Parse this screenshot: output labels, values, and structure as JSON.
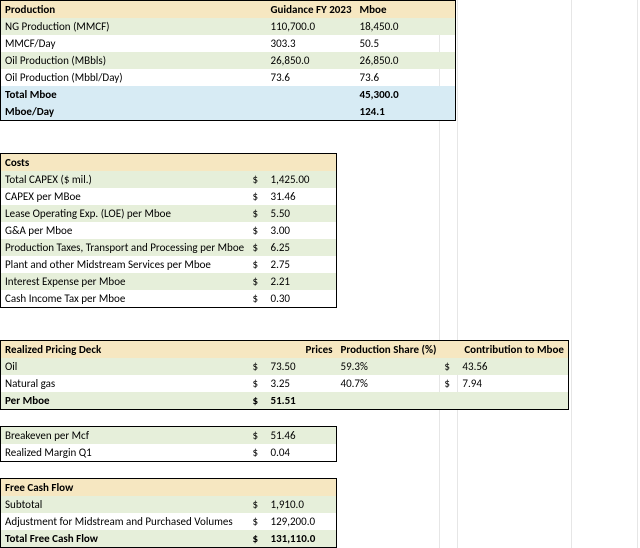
{
  "production": {
    "header": {
      "label": "Production",
      "col2": "Guidance FY 2023",
      "col3": "Mboe"
    },
    "rows": [
      {
        "label": "NG Production (MMCF)",
        "g": "110,700.0",
        "m": "18,450.0"
      },
      {
        "label": "MMCF/Day",
        "g": "303.3",
        "m": "50.5"
      },
      {
        "label": "Oil Production (MBbls)",
        "g": "26,850.0",
        "m": "26,850.0"
      },
      {
        "label": "Oil Production (Mbbl/Day)",
        "g": "73.6",
        "m": "73.6"
      }
    ],
    "total": {
      "label": "Total Mboe",
      "m": "45,300.0"
    },
    "perday": {
      "label": "Mboe/Day",
      "m": "124.1"
    }
  },
  "costs": {
    "header": "Costs",
    "rows": [
      {
        "label": "Total CAPEX ($ mil.)",
        "cur": "$",
        "val": "1,425.00"
      },
      {
        "label": "CAPEX per MBoe",
        "cur": "$",
        "val": "31.46"
      },
      {
        "label": "Lease Operating Exp. (LOE) per Mboe",
        "cur": "$",
        "val": "5.50"
      },
      {
        "label": "G&A per Mboe",
        "cur": "$",
        "val": "3.00"
      },
      {
        "label": "Production Taxes, Transport and Processing per Mboe",
        "cur": "$",
        "val": "6.25"
      },
      {
        "label": "Plant and other Midstream Services per Mboe",
        "cur": "$",
        "val": "2.75"
      },
      {
        "label": "Interest Expense per Mboe",
        "cur": "$",
        "val": "2.21"
      },
      {
        "label": "Cash Income Tax per Mboe",
        "cur": "$",
        "val": "0.30"
      }
    ]
  },
  "pricing": {
    "header": {
      "label": "Realized Pricing Deck",
      "c2": "Prices",
      "c3": "Production Share (%)",
      "c4": "Contribution to Mboe"
    },
    "rows": [
      {
        "label": "Oil",
        "cur": "$",
        "price": "73.50",
        "share": "59.3%",
        "ccur": "$",
        "contrib": "43.56"
      },
      {
        "label": "Natural gas",
        "cur": "$",
        "price": "3.25",
        "share": "40.7%",
        "ccur": "$",
        "contrib": "7.94"
      }
    ],
    "total": {
      "label": "Per Mboe",
      "cur": "$",
      "price": "51.51"
    }
  },
  "breakeven": {
    "rows": [
      {
        "label": "Breakeven per Mcf",
        "cur": "$",
        "val": "51.46"
      },
      {
        "label": "Realized Margin Q1",
        "cur": "$",
        "val": "0.04"
      }
    ]
  },
  "fcf": {
    "header": "Free Cash Flow",
    "rows": [
      {
        "label": "Subtotal",
        "cur": "$",
        "val": "1,910.0"
      },
      {
        "label": "Adjustment for Midstream and Purchased Volumes",
        "cur": "$",
        "val": "129,200.0"
      }
    ],
    "total": {
      "label": "Total Free Cash Flow",
      "cur": "$",
      "val": "131,110.0"
    }
  }
}
